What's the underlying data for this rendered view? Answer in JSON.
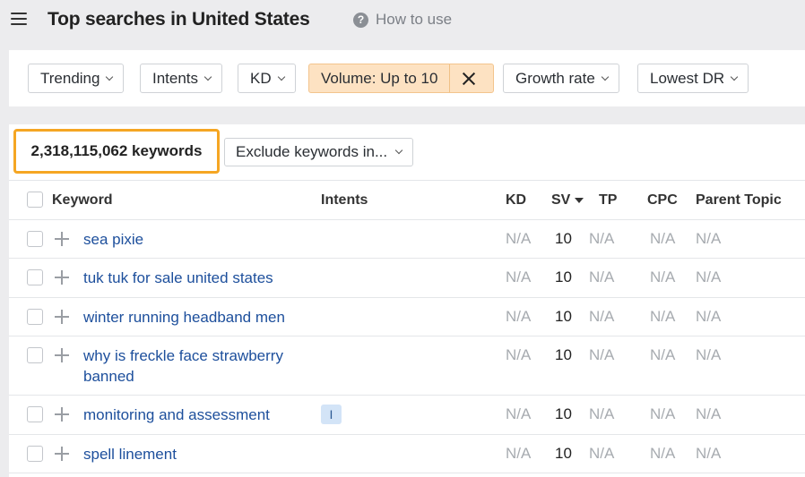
{
  "header": {
    "title": "Top searches in United States",
    "help_label": "How to use",
    "help_icon": "?"
  },
  "filters": {
    "trending": "Trending",
    "intents": "Intents",
    "kd": "KD",
    "volume": "Volume: Up to 10",
    "growth": "Growth rate",
    "lowest_dr": "Lowest DR"
  },
  "results": {
    "count_label": "2,318,115,062 keywords",
    "exclude_label": "Exclude keywords in..."
  },
  "table": {
    "columns": {
      "keyword": "Keyword",
      "intents": "Intents",
      "kd": "KD",
      "sv": "SV",
      "tp": "TP",
      "cpc": "CPC",
      "parent": "Parent Topic"
    },
    "rows": [
      {
        "keyword": "sea pixie",
        "intent": "",
        "kd": "N/A",
        "sv": "10",
        "tp": "N/A",
        "cpc": "N/A",
        "parent": "N/A"
      },
      {
        "keyword": "tuk tuk for sale united states",
        "intent": "",
        "kd": "N/A",
        "sv": "10",
        "tp": "N/A",
        "cpc": "N/A",
        "parent": "N/A"
      },
      {
        "keyword": "winter running headband men",
        "intent": "",
        "kd": "N/A",
        "sv": "10",
        "tp": "N/A",
        "cpc": "N/A",
        "parent": "N/A"
      },
      {
        "keyword": "why is freckle face strawberry banned",
        "intent": "",
        "kd": "N/A",
        "sv": "10",
        "tp": "N/A",
        "cpc": "N/A",
        "parent": "N/A"
      },
      {
        "keyword": "monitoring and assessment",
        "intent": "I",
        "kd": "N/A",
        "sv": "10",
        "tp": "N/A",
        "cpc": "N/A",
        "parent": "N/A"
      },
      {
        "keyword": "spell linement",
        "intent": "",
        "kd": "N/A",
        "sv": "10",
        "tp": "N/A",
        "cpc": "N/A",
        "parent": "N/A"
      }
    ]
  },
  "colors": {
    "accent_highlight": "#f5a623",
    "active_filter_bg": "#fde2c2",
    "link": "#1d4f9c"
  }
}
